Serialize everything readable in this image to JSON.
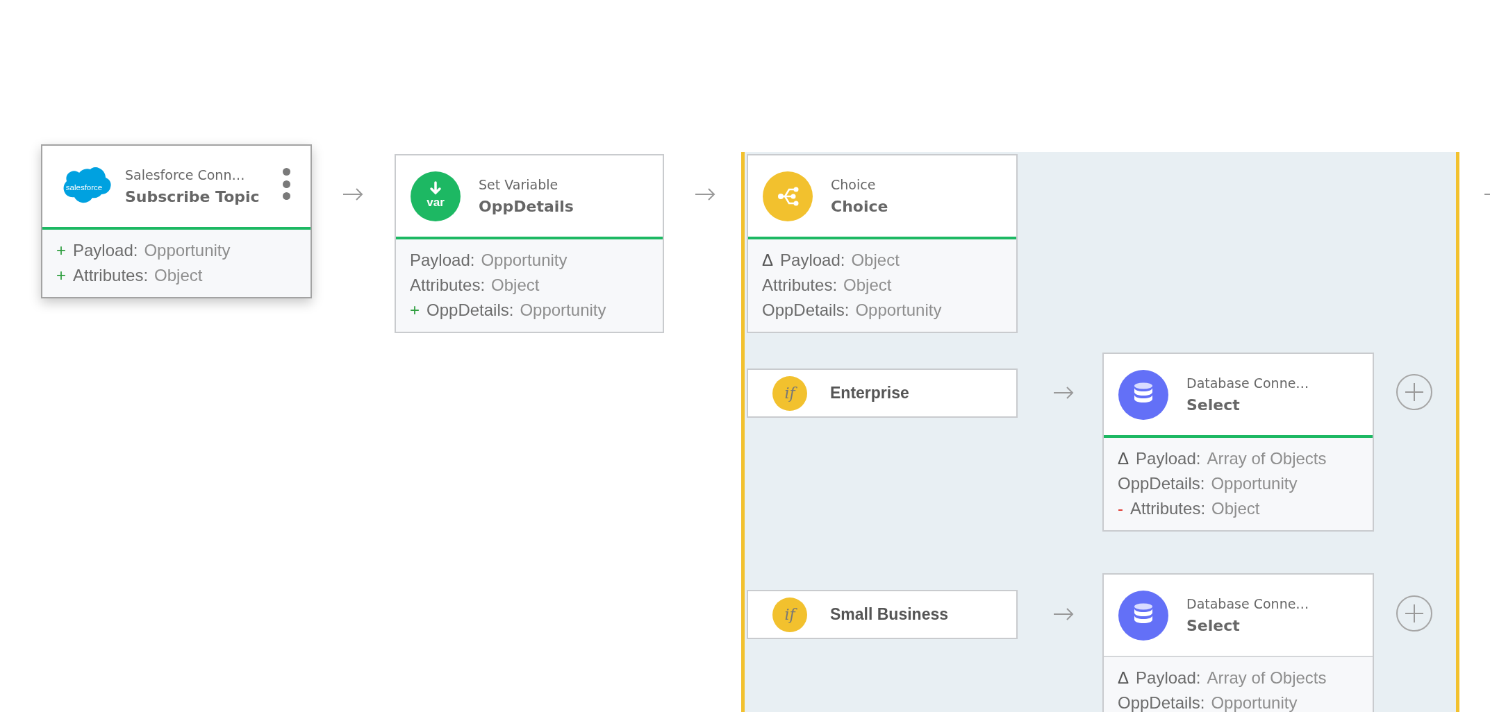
{
  "flow": [
    {
      "kind": "salesforce",
      "logo_text": "salesforce",
      "subtitle": "Salesforce Conn…",
      "title": "Subscribe Topic",
      "selected": true,
      "status_bar": true,
      "fields": [
        {
          "kind": "added",
          "mark": "+",
          "name": "Payload:",
          "type": "Opportunity"
        },
        {
          "kind": "added",
          "mark": "+",
          "name": "Attributes:",
          "type": "Object"
        }
      ]
    },
    {
      "kind": "variable",
      "logo_text": "var",
      "subtitle": "Set Variable",
      "title": "OppDetails",
      "selected": false,
      "status_bar": true,
      "fields": [
        {
          "kind": "plain",
          "name": "Payload:",
          "type": "Opportunity"
        },
        {
          "kind": "plain",
          "name": "Attributes:",
          "type": "Object"
        },
        {
          "kind": "added",
          "mark": "+",
          "name": "OppDetails:",
          "type": "Opportunity"
        }
      ]
    }
  ],
  "choice": {
    "node": {
      "kind": "choice",
      "subtitle": "Choice",
      "title": "Choice",
      "selected": false,
      "status_bar": true,
      "fields": [
        {
          "kind": "modified",
          "mark": "Δ",
          "name": "Payload:",
          "type": "Object"
        },
        {
          "kind": "plain",
          "name": "Attributes:",
          "type": "Object"
        },
        {
          "kind": "plain",
          "name": "OppDetails:",
          "type": "Opportunity"
        }
      ]
    },
    "branches": [
      {
        "badge": "if",
        "label": "Enterprise",
        "node": {
          "kind": "database",
          "subtitle": "Database Conne…",
          "title": "Select",
          "selected": false,
          "status_bar": true,
          "fields": [
            {
              "kind": "modified",
              "mark": "Δ",
              "name": "Payload:",
              "type": "Array of Objects"
            },
            {
              "kind": "plain",
              "name": "OppDetails:",
              "type": "Opportunity"
            },
            {
              "kind": "removed",
              "mark": "-",
              "name": "Attributes:",
              "type": "Object"
            }
          ]
        }
      },
      {
        "badge": "if",
        "label": "Small Business",
        "node": {
          "kind": "database",
          "subtitle": "Database Conne…",
          "title": "Select",
          "selected": false,
          "status_bar": false,
          "fields": [
            {
              "kind": "modified",
              "mark": "Δ",
              "name": "Payload:",
              "type": "Array of Objects"
            },
            {
              "kind": "plain",
              "name": "OppDetails:",
              "type": "Opportunity"
            }
          ]
        }
      }
    ]
  }
}
